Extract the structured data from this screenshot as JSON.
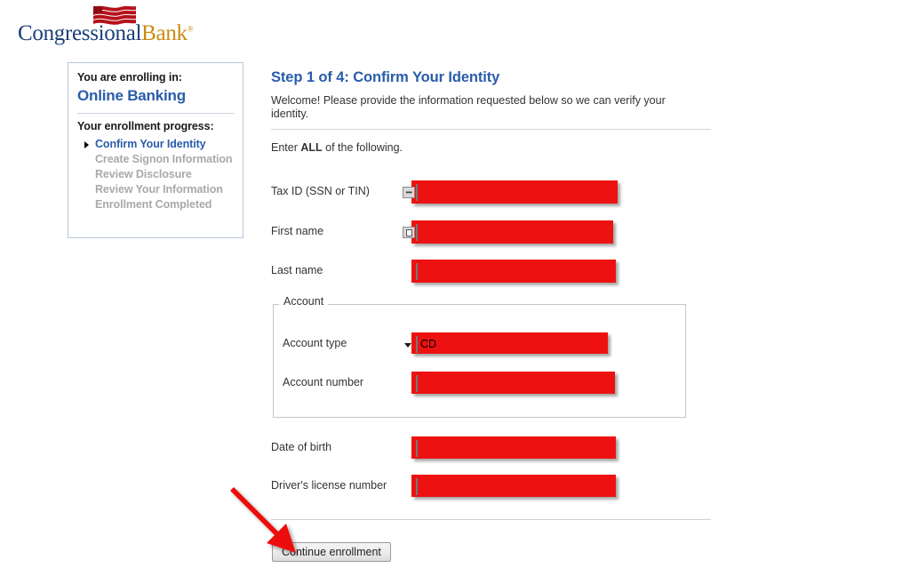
{
  "logo": {
    "word_primary": "Congressional",
    "word_secondary": "Bank",
    "registered_mark": "®",
    "icon": "flag-icon",
    "colors": {
      "primary": "#1b3f7a",
      "secondary": "#c98a10",
      "flag": "#b5121b"
    }
  },
  "sidebar": {
    "lead_label": "You are enrolling in:",
    "product": "Online Banking",
    "progress_title": "Your enrollment progress:",
    "steps": [
      {
        "label": "Confirm Your Identity",
        "state": "current"
      },
      {
        "label": "Create Signon Information",
        "state": "pending"
      },
      {
        "label": "Review Disclosure",
        "state": "pending"
      },
      {
        "label": "Review Your Information",
        "state": "pending"
      },
      {
        "label": "Enrollment Completed",
        "state": "pending"
      }
    ]
  },
  "main": {
    "heading": "Step 1 of 4: Confirm Your Identity",
    "intro": "Welcome! Please provide the information requested below so we can verify your identity.",
    "instruction_prefix": "Enter ",
    "instruction_emphasis": "ALL",
    "instruction_suffix": " of the following."
  },
  "fields": {
    "tax_id": {
      "label": "Tax ID (SSN or TIN)",
      "value": "",
      "icon": "autofill-dots-icon"
    },
    "first_name": {
      "label": "First name",
      "value": "",
      "icon": "autofill-card-icon"
    },
    "last_name": {
      "label": "Last name",
      "value": ""
    },
    "account_legend": "Account",
    "account_type": {
      "label": "Account type",
      "value": "CD",
      "icon": "chevron-down-icon"
    },
    "account_number": {
      "label": "Account number",
      "value": ""
    },
    "date_of_birth": {
      "label": "Date of birth",
      "value": ""
    },
    "drivers_license": {
      "label": "Driver's license number",
      "value": ""
    }
  },
  "footer": {
    "continue_label": "Continue enrollment"
  },
  "annotation": {
    "type": "arrow",
    "color": "#ee1111",
    "points_to": "continue-enrollment-button"
  },
  "theme": {
    "highlight_red": "#ee1111",
    "link_blue": "#2a5caa",
    "muted_gray": "#a9a9a9",
    "background": "#ffffff"
  }
}
